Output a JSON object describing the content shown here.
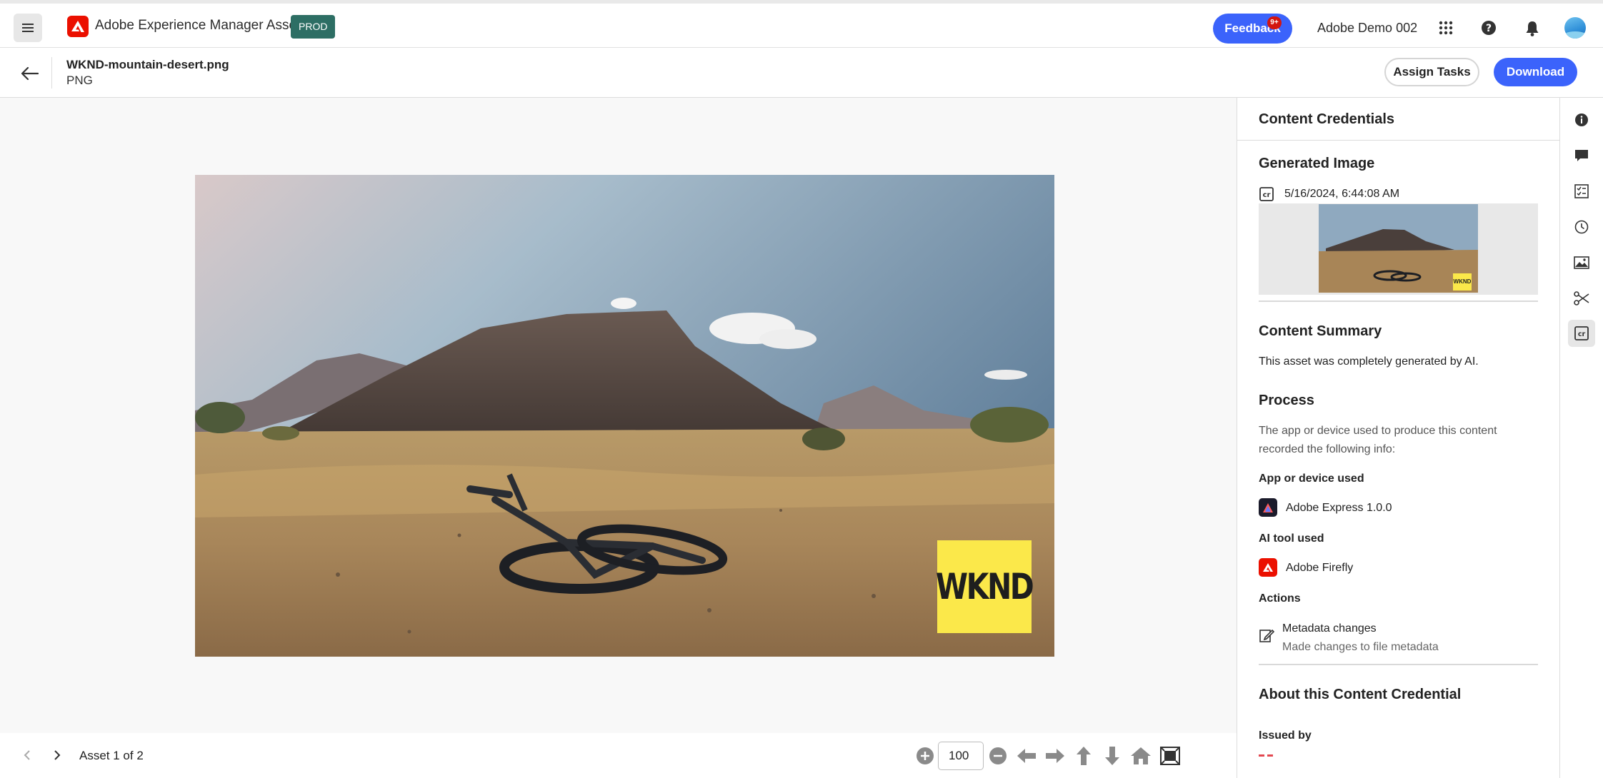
{
  "shell": {
    "app_title": "Adobe Experience Manager Assets",
    "env_badge": "PROD",
    "feedback_label": "Feedback",
    "org_name": "Adobe Demo 002",
    "notification_count": "9+",
    "icons": [
      "menu-icon",
      "adobe-logo-icon",
      "apps-grid-icon",
      "help-icon",
      "bell-icon",
      "avatar"
    ]
  },
  "asset": {
    "file_name": "WKND-mountain-desert.png",
    "file_type": "PNG",
    "assign_label": "Assign Tasks",
    "download_label": "Download"
  },
  "preview": {
    "overlay_text": "WKND",
    "thumb_overlay_text": "WKND"
  },
  "bottom_bar": {
    "counter": "Asset 1 of 2",
    "zoom_value": "100",
    "tools": [
      "zoom-in-icon",
      "zoom-out-icon",
      "pan-left-icon",
      "pan-right-icon",
      "pan-up-icon",
      "pan-down-icon",
      "home-icon",
      "fit-to-screen-icon"
    ]
  },
  "panel": {
    "title": "Content Credentials",
    "generated_heading": "Generated Image",
    "generated_date": "5/16/2024, 6:44:08 AM",
    "summary_heading": "Content Summary",
    "summary_text": "This asset was completely generated by AI.",
    "process_heading": "Process",
    "process_line1": "The app or device used to produce this content",
    "process_line2": "recorded the following info:",
    "app_heading": "App or device used",
    "app_name": "Adobe Express 1.0.0",
    "ai_heading": "AI tool used",
    "ai_name": "Adobe Firefly",
    "actions_heading": "Actions",
    "action_title": "Metadata changes",
    "action_desc": "Made changes to file metadata",
    "about_heading": "About this Content Credential",
    "issued_heading": "Issued by"
  },
  "rail": {
    "items": [
      "info-icon",
      "comment-icon",
      "tasks-icon",
      "history-icon",
      "renditions-icon",
      "cut-icon",
      "content-credentials-icon"
    ],
    "active": "content-credentials-icon"
  },
  "colors": {
    "accent": "#3b63fb",
    "env_badge": "#2d6e64",
    "notification": "#d31510",
    "wknd_yellow": "#fbe84a",
    "adobe_red": "#eb1000"
  }
}
